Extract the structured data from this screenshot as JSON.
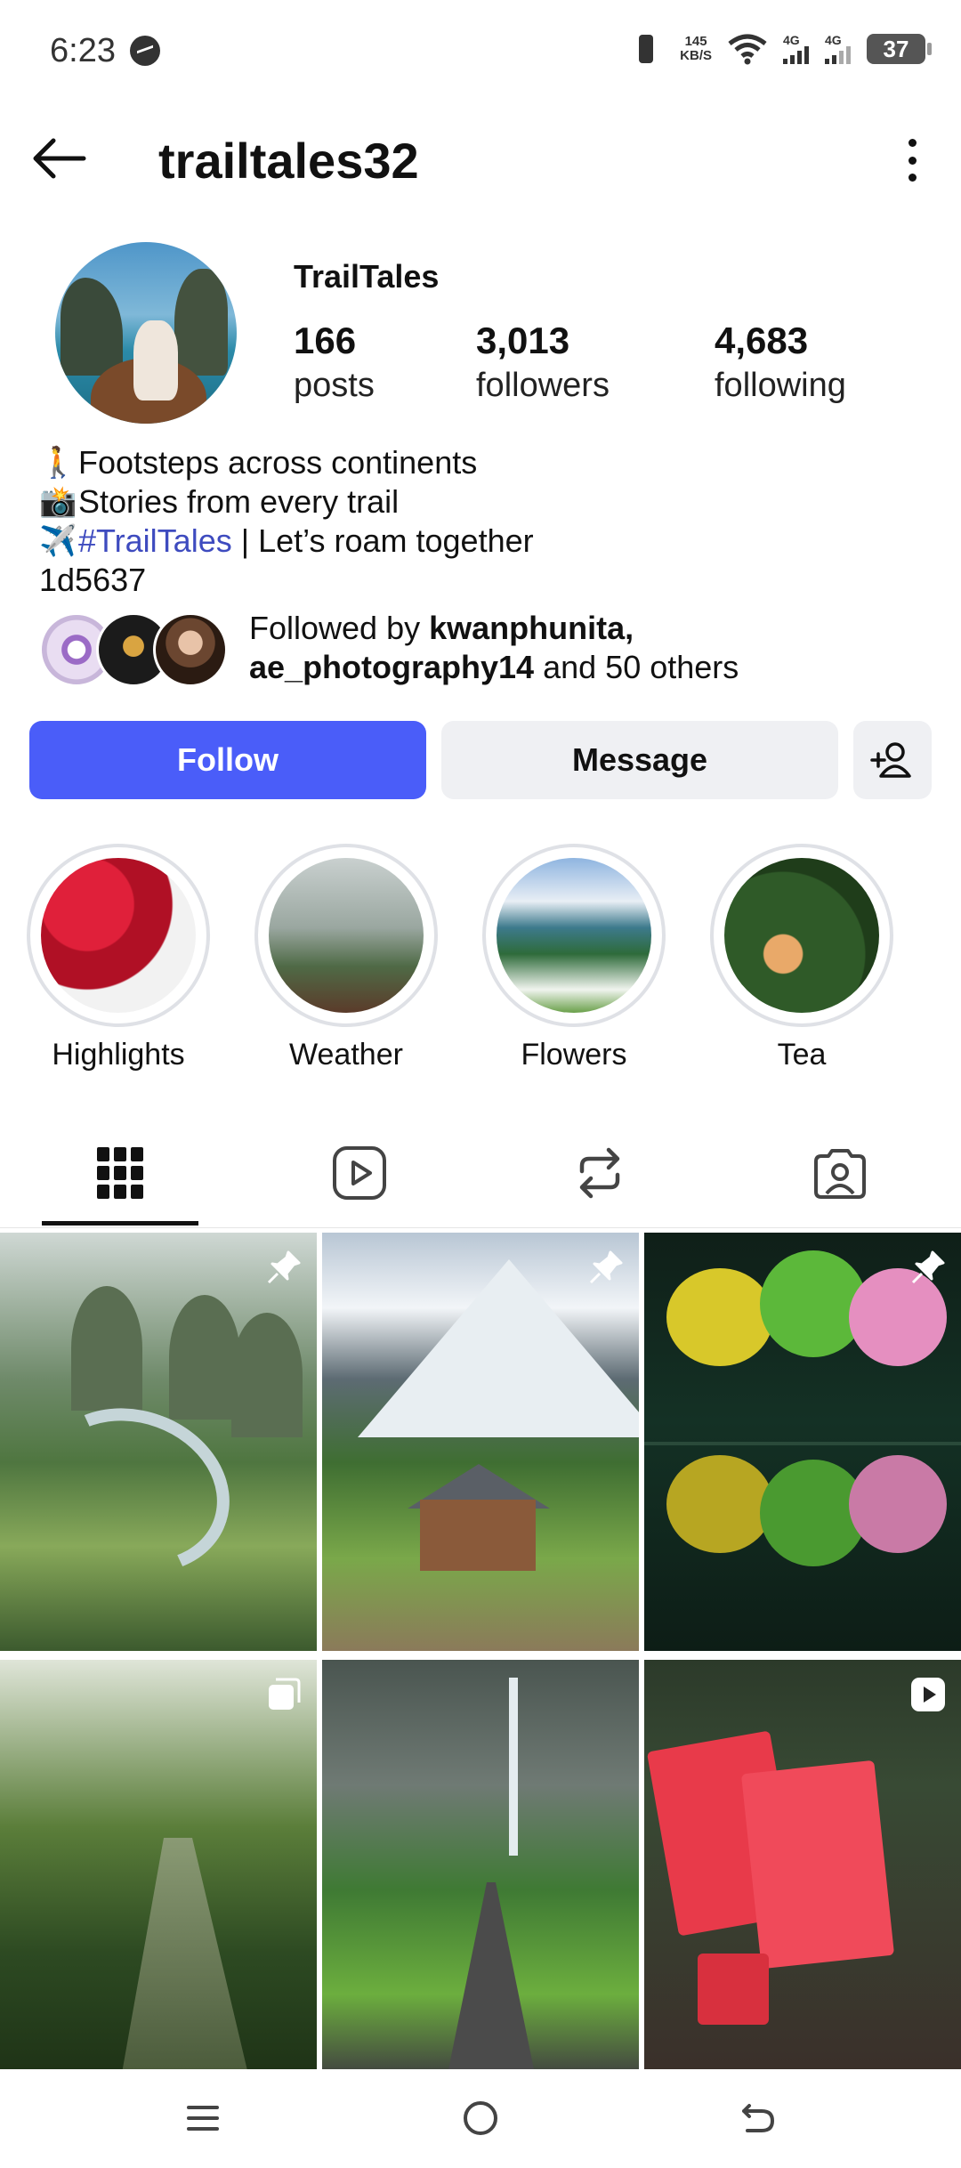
{
  "status_bar": {
    "time": "6:23",
    "net_speed_value": "145",
    "net_speed_unit": "KB/S",
    "signal1_label": "4G",
    "signal2_label": "4G",
    "battery": "37"
  },
  "header": {
    "username": "trailtales32"
  },
  "profile": {
    "display_name": "TrailTales",
    "stats": [
      {
        "value": "166",
        "label": "posts"
      },
      {
        "value": "3,013",
        "label": "followers"
      },
      {
        "value": "4,683",
        "label": "following"
      }
    ],
    "bio": {
      "line1_emoji": "🚶",
      "line1": "Footsteps across continents",
      "line2_emoji": "📸",
      "line2": "Stories from every trail",
      "line3_emoji": "✈️",
      "line3_tag": "#TrailTales",
      "line3_rest": " | Let’s roam together",
      "line4": "1d5637"
    },
    "mutual": {
      "prefix": "Followed by ",
      "user1": "kwanphunita,",
      "user2": "ae_photography14",
      "middle": " and ",
      "count": "50",
      "suffix": " others"
    }
  },
  "actions": {
    "follow": "Follow",
    "message": "Message"
  },
  "highlights": [
    {
      "label": "Highlights"
    },
    {
      "label": "Weather"
    },
    {
      "label": "Flowers"
    },
    {
      "label": "Tea"
    }
  ],
  "tabs": {
    "active": "grid"
  },
  "icons": {
    "back": "back-arrow-icon",
    "more": "more-vertical-icon",
    "add_user": "add-user-icon",
    "grid": "grid-icon",
    "reels": "reels-icon",
    "reposts": "repost-icon",
    "tagged": "tagged-icon",
    "pin": "pin-icon",
    "multi": "multiple-posts-icon",
    "video": "video-icon"
  },
  "colors": {
    "accent": "#4a5df9",
    "hashtag": "#3e4bbf",
    "button_bg": "#eff0f3"
  }
}
